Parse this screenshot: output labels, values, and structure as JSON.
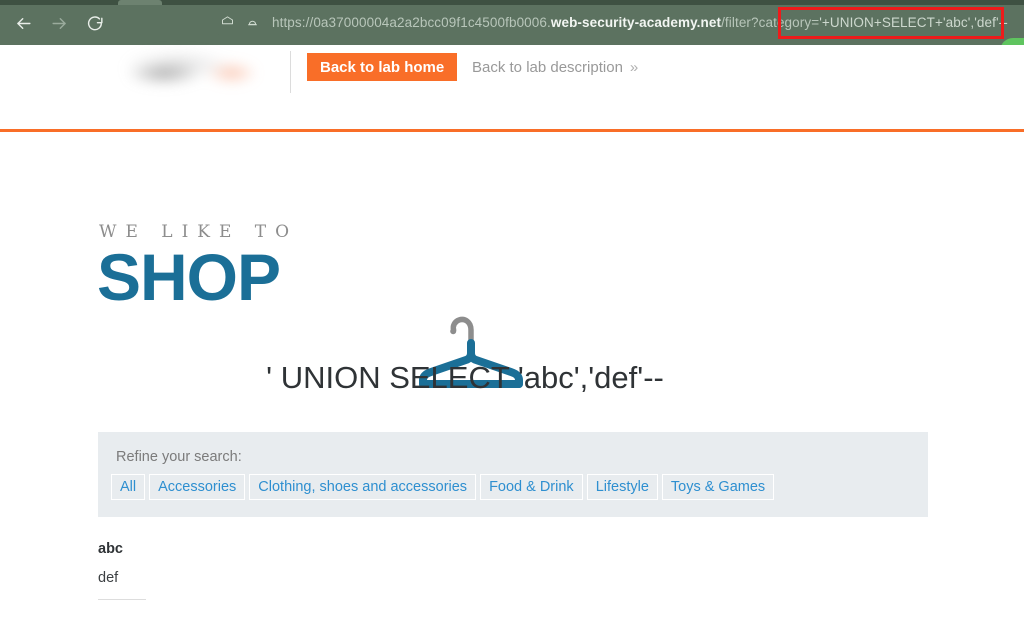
{
  "browser": {
    "back_icon": "arrow-left-icon",
    "forward_icon": "arrow-right-icon",
    "reload_icon": "reload-icon",
    "shield_icon": "shield-icon",
    "profile_icon": "profile-icon",
    "url": {
      "full": "https://0a37000004a2a2bcc09f1c4500fb0006.web-security-academy.net/filter?category='+UNION+SELECT+'abc','def'--",
      "scheme": "https://",
      "subdomain": "0a37000004a2a2bcc09f1c4500fb0006.",
      "domain": "web-security-academy.net",
      "path": "/filter?category=",
      "query_highlighted": "'+UNION+SELECT+'abc','def'--"
    },
    "highlight_color": "#ee1b1b",
    "chrome_color": "#5c7260"
  },
  "lab_header": {
    "logo_alt": "web-security-academy-logo",
    "back_home_label": "Back to lab home",
    "back_description_label": "Back to lab description",
    "back_description_chevron": "»",
    "accent_color": "#f96e28",
    "status_color": "#5fc45f"
  },
  "shop": {
    "logo_tagline": "WE LIKE TO",
    "logo_word": "SHOP",
    "logo_icon": "clothes-hanger-icon",
    "logo_color": "#1b6f97",
    "search_heading": "' UNION SELECT 'abc','def'--",
    "refine": {
      "label": "Refine your search:",
      "filters": [
        {
          "label": "All"
        },
        {
          "label": "Accessories"
        },
        {
          "label": "Clothing, shoes and accessories"
        },
        {
          "label": "Food & Drink"
        },
        {
          "label": "Lifestyle"
        },
        {
          "label": "Toys & Games"
        }
      ]
    },
    "results": [
      {
        "name": "abc",
        "description": "def"
      }
    ]
  }
}
